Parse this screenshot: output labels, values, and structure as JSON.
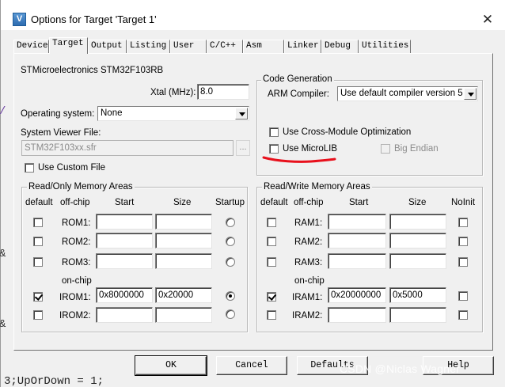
{
  "window": {
    "title": "Options for Target 'Target 1'",
    "close_glyph": "✕",
    "icon_glyph": "V"
  },
  "tabs": [
    {
      "label": "Device",
      "active": false
    },
    {
      "label": "Target",
      "active": true
    },
    {
      "label": "Output",
      "active": false
    },
    {
      "label": "Listing",
      "active": false
    },
    {
      "label": "User",
      "active": false
    },
    {
      "label": "C/C++",
      "active": false
    },
    {
      "label": "Asm",
      "active": false
    },
    {
      "label": "Linker",
      "active": false
    },
    {
      "label": "Debug",
      "active": false
    },
    {
      "label": "Utilities",
      "active": false
    }
  ],
  "device_name": "STMicroelectronics STM32F103RB",
  "xtal": {
    "label": "Xtal (MHz):",
    "value": "8.0"
  },
  "os": {
    "label": "Operating system:",
    "value": "None"
  },
  "system_viewer": {
    "label": "System Viewer File:",
    "value": "STM32F103xx.sfr",
    "browse_label": "..."
  },
  "use_custom_file": {
    "label": "Use Custom File",
    "checked": false
  },
  "code_generation": {
    "title": "Code Generation",
    "compiler_label": "ARM Compiler:",
    "compiler_value": "Use default compiler version 5",
    "cross_module": {
      "label": "Use Cross-Module Optimization",
      "checked": false
    },
    "microlib": {
      "label": "Use MicroLIB",
      "checked": false
    },
    "big_endian": {
      "label": "Big Endian",
      "checked": false,
      "enabled": false
    }
  },
  "readonly_memory": {
    "title": "Read/Only Memory Areas",
    "headers": {
      "default": "default",
      "offchip": "off-chip",
      "start": "Start",
      "size": "Size",
      "startup": "Startup"
    },
    "onchip_label": "on-chip",
    "rows": [
      {
        "name": "ROM1:",
        "default": false,
        "start": "",
        "size": "",
        "startup": false
      },
      {
        "name": "ROM2:",
        "default": false,
        "start": "",
        "size": "",
        "startup": false
      },
      {
        "name": "ROM3:",
        "default": false,
        "start": "",
        "size": "",
        "startup": false
      },
      {
        "name": "IROM1:",
        "default": true,
        "start": "0x8000000",
        "size": "0x20000",
        "startup": true
      },
      {
        "name": "IROM2:",
        "default": false,
        "start": "",
        "size": "",
        "startup": false
      }
    ]
  },
  "readwrite_memory": {
    "title": "Read/Write Memory Areas",
    "headers": {
      "default": "default",
      "offchip": "off-chip",
      "start": "Start",
      "size": "Size",
      "noinit": "NoInit"
    },
    "onchip_label": "on-chip",
    "rows": [
      {
        "name": "RAM1:",
        "default": false,
        "start": "",
        "size": "",
        "noinit": false
      },
      {
        "name": "RAM2:",
        "default": false,
        "start": "",
        "size": "",
        "noinit": false
      },
      {
        "name": "RAM3:",
        "default": false,
        "start": "",
        "size": "",
        "noinit": false
      },
      {
        "name": "IRAM1:",
        "default": true,
        "start": "0x20000000",
        "size": "0x5000",
        "noinit": false
      },
      {
        "name": "IRAM2:",
        "default": false,
        "start": "",
        "size": "",
        "noinit": false
      }
    ]
  },
  "buttons": {
    "ok": "OK",
    "cancel": "Cancel",
    "defaults": "Defaults",
    "help": "Help"
  },
  "watermark": "CSDN @Niclas Wagner",
  "background_code": "3;UpOrDown = 1;",
  "annotation_color": "#e8101c"
}
